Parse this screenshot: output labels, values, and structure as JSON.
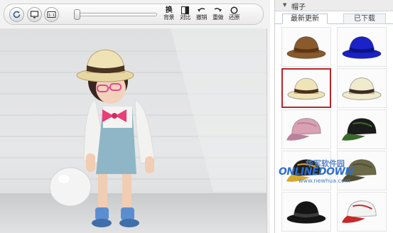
{
  "toolbar": {
    "buttons": [
      {
        "icon": "refresh-icon"
      },
      {
        "icon": "monitor-icon"
      },
      {
        "icon": "actual-size-icon",
        "label": "1:1"
      }
    ],
    "slider": {
      "value": 0
    },
    "tools": [
      {
        "icon": "swap-icon",
        "label_top": "换",
        "label": "背景"
      },
      {
        "icon": "compare-icon",
        "label": "对比"
      },
      {
        "icon": "undo-icon",
        "label": "撤销"
      },
      {
        "icon": "redo-icon",
        "label": "重做"
      },
      {
        "icon": "restore-icon",
        "label": "还原"
      }
    ]
  },
  "panel": {
    "header": "帽子",
    "tabs": [
      {
        "label": "最新更新",
        "active": true
      },
      {
        "label": "已下载",
        "active": false
      }
    ],
    "items": [
      {
        "name": "brown-fedora",
        "color": "#8a5a2b",
        "band": "#5b3515",
        "type": "fedora"
      },
      {
        "name": "blue-fedora",
        "color": "#1a22c8",
        "band": "#0c1280",
        "type": "fedora"
      },
      {
        "name": "straw-hat-selected",
        "color": "#efe3b8",
        "band": "#4a2f1a",
        "type": "fedora",
        "selected": true
      },
      {
        "name": "straw-hat-light",
        "color": "#f1ebce",
        "band": "#3b2b20",
        "type": "fedora"
      },
      {
        "name": "pink-floral-cap",
        "color": "#d9a1b3",
        "band": "#b8829a",
        "type": "cap"
      },
      {
        "name": "black-printed-cap",
        "color": "#1b1b1b",
        "band": "#3a6a2a",
        "type": "cap"
      },
      {
        "name": "black-ornate-hat",
        "color": "#202020",
        "band": "#d4a92c",
        "type": "cap"
      },
      {
        "name": "olive-army-cap",
        "color": "#6b6a48",
        "band": "#4f4e33",
        "type": "cap"
      },
      {
        "name": "black-bow-hat",
        "color": "#151515",
        "band": "#3a3a3a",
        "type": "fedora"
      },
      {
        "name": "white-graphic-cap",
        "color": "#f3f3f3",
        "band": "#c8282a",
        "type": "cap"
      }
    ]
  },
  "watermark": {
    "line1": "华军软件园",
    "line2": "ONLINEDOWN",
    "line3": "www.newhua.com"
  }
}
